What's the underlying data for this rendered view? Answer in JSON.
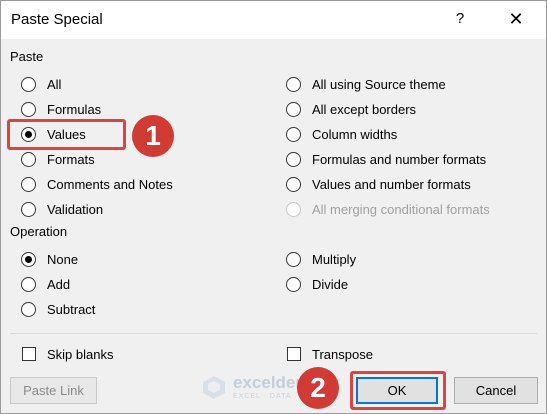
{
  "dialog": {
    "title": "Paste Special",
    "help_label": "?",
    "close_label": "✕"
  },
  "paste": {
    "group_label": "Paste",
    "left_options": [
      {
        "label": "All",
        "checked": false,
        "disabled": false
      },
      {
        "label": "Formulas",
        "checked": false,
        "disabled": false
      },
      {
        "label": "Values",
        "checked": true,
        "disabled": false
      },
      {
        "label": "Formats",
        "checked": false,
        "disabled": false
      },
      {
        "label": "Comments and Notes",
        "checked": false,
        "disabled": false
      },
      {
        "label": "Validation",
        "checked": false,
        "disabled": false
      }
    ],
    "right_options": [
      {
        "label": "All using Source theme",
        "checked": false,
        "disabled": false
      },
      {
        "label": "All except borders",
        "checked": false,
        "disabled": false
      },
      {
        "label": "Column widths",
        "checked": false,
        "disabled": false
      },
      {
        "label": "Formulas and number formats",
        "checked": false,
        "disabled": false
      },
      {
        "label": "Values and number formats",
        "checked": false,
        "disabled": false
      },
      {
        "label": "All merging conditional formats",
        "checked": false,
        "disabled": true
      }
    ]
  },
  "operation": {
    "group_label": "Operation",
    "left_options": [
      {
        "label": "None",
        "checked": true
      },
      {
        "label": "Add",
        "checked": false
      },
      {
        "label": "Subtract",
        "checked": false
      }
    ],
    "right_options": [
      {
        "label": "Multiply",
        "checked": false
      },
      {
        "label": "Divide",
        "checked": false
      }
    ]
  },
  "checkboxes": {
    "skip_blanks": {
      "label": "Skip blanks",
      "checked": false
    },
    "transpose": {
      "label": "Transpose",
      "checked": false
    }
  },
  "buttons": {
    "paste_link": "Paste Link",
    "ok": "OK",
    "cancel": "Cancel"
  },
  "annotations": {
    "badge_1": "1",
    "badge_2": "2",
    "highlight_color": "#e1423d"
  },
  "watermark": {
    "name": "exceldemy",
    "tagline": "EXCEL · DATA · BI"
  }
}
